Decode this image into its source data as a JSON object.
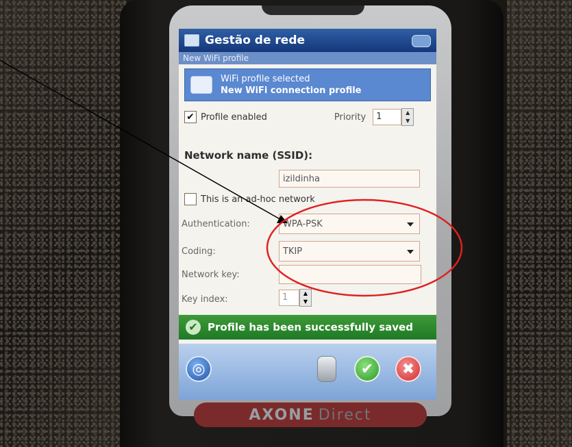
{
  "window": {
    "title": "Gestão de rede",
    "subtitle": "New WiFi profile"
  },
  "banner": {
    "line1": "WiFi profile selected",
    "line2": "New WiFi connection profile"
  },
  "profile": {
    "enabled_label": "Profile enabled",
    "enabled_checked": "✔",
    "priority_label": "Priority",
    "priority_value": "1"
  },
  "network": {
    "section_label": "Network name (SSID):",
    "ssid_value": "izildinha",
    "adhoc_label": "This is an ad-hoc network"
  },
  "authentication": {
    "label": "Authentication:",
    "value": "WPA-PSK"
  },
  "coding": {
    "label": "Coding:",
    "value": "TKIP"
  },
  "network_key": {
    "label": "Network key:",
    "value": ""
  },
  "key_index": {
    "label": "Key index:",
    "value": "1"
  },
  "status": {
    "message": "Profile has been successfully saved"
  },
  "toolbar": {
    "buttons": [
      "globe-icon",
      "phone-icon",
      "check-icon",
      "close-icon"
    ]
  },
  "device": {
    "brand_word1": "AXONE",
    "brand_word2": "Direct"
  },
  "colors": {
    "titlebar": "#14377a",
    "status": "#1e7a25",
    "annotation_circle": "#e02020"
  }
}
